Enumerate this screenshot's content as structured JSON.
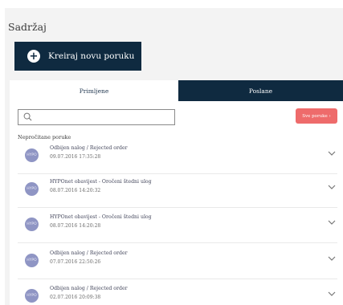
{
  "page": {
    "title": "Sadržaj"
  },
  "create_button": {
    "label": "Kreiraj novu poruku"
  },
  "tabs": [
    {
      "label": "Primljene"
    },
    {
      "label": "Poslane"
    }
  ],
  "search": {
    "placeholder": "",
    "value": ""
  },
  "filter_button": {
    "label": "Sve poruke ›"
  },
  "section": {
    "label": "Nepročitane poruke"
  },
  "messages": [
    {
      "avatar": "HYPO",
      "subject": "Odbijen nalog / Rejected order",
      "date": "09.07.2016 17:35:28"
    },
    {
      "avatar": "HYPO",
      "subject": "HYPOnet obavijest - Oročeni štedni ulog",
      "date": "08.07.2016 14:20:32"
    },
    {
      "avatar": "HYPO",
      "subject": "HYPOnet obavijest - Oročeni štedni ulog",
      "date": "08.07.2016 14:20:28"
    },
    {
      "avatar": "HYPO",
      "subject": "Odbijen nalog / Rejected order",
      "date": "07.07.2016 22:50:26"
    },
    {
      "avatar": "HYPO",
      "subject": "Odbijen nalog / Rejected order",
      "date": "02.07.2016 20:09:38"
    }
  ],
  "colors": {
    "navy": "#0f2a40",
    "accent_red": "#ee6b6b",
    "avatar": "#8f95c4"
  },
  "icons": {
    "search": "search-icon",
    "expand": "chevron-down-icon",
    "create": "plus-icon"
  }
}
